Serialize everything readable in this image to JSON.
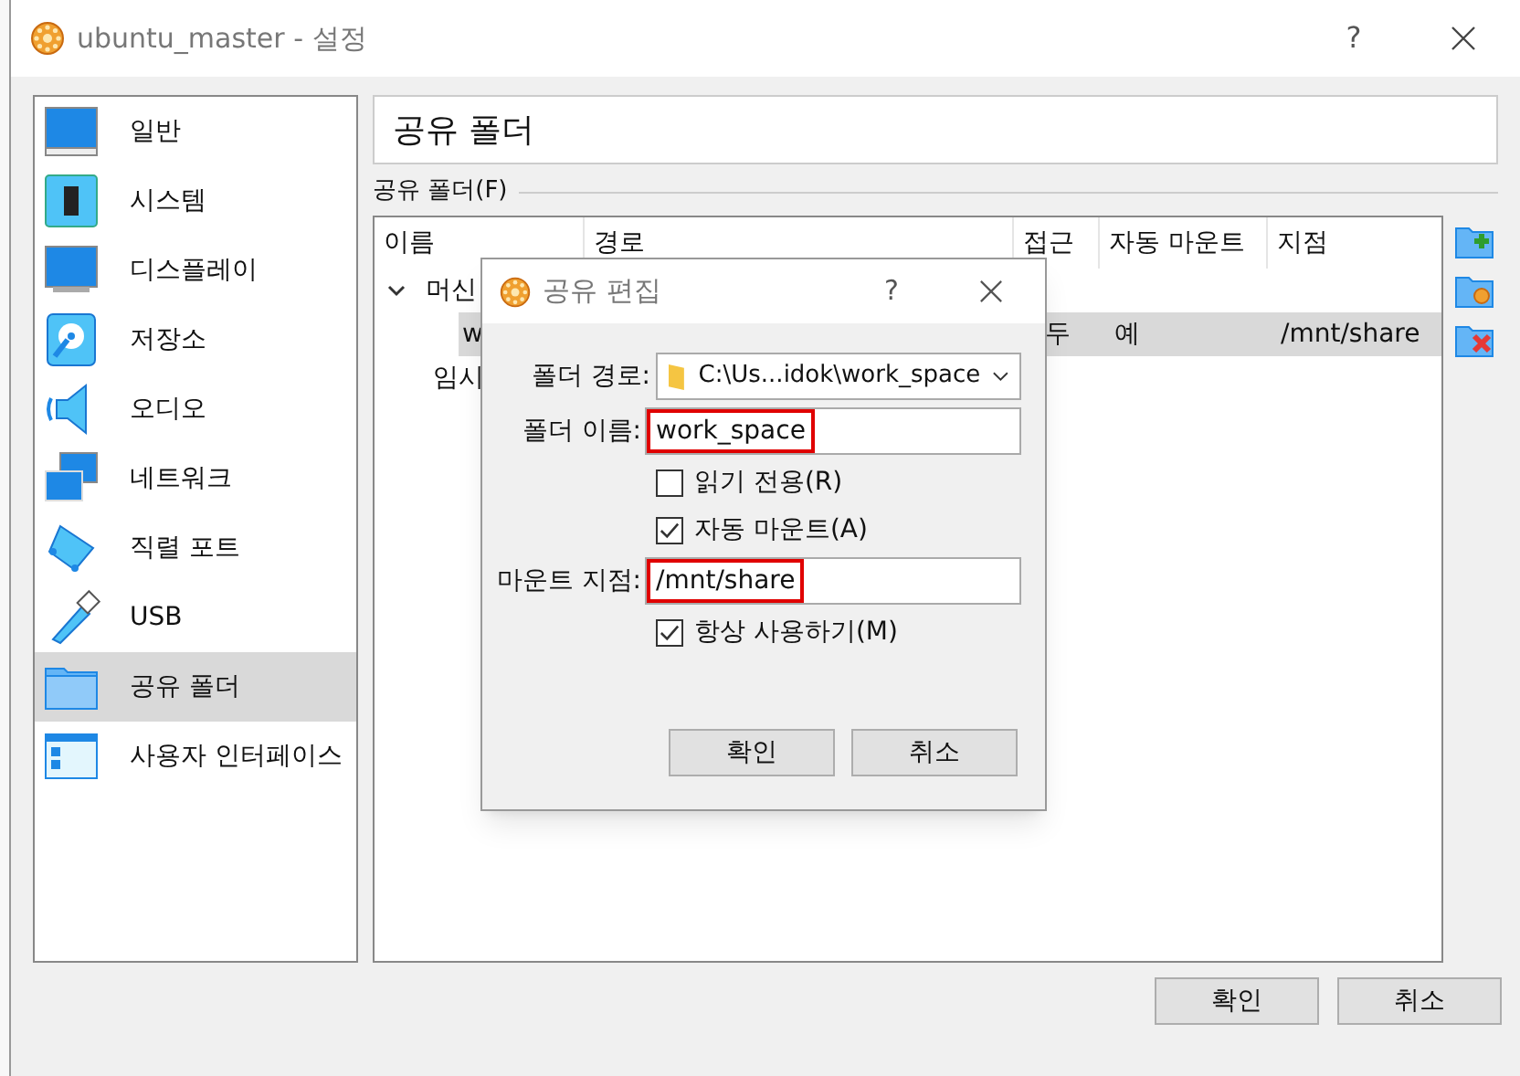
{
  "window": {
    "title": "ubuntu_master - 설정",
    "help": "?"
  },
  "sidebar": {
    "items": [
      {
        "label": "일반",
        "selected": false
      },
      {
        "label": "시스템",
        "selected": false
      },
      {
        "label": "디스플레이",
        "selected": false
      },
      {
        "label": "저장소",
        "selected": false
      },
      {
        "label": "오디오",
        "selected": false
      },
      {
        "label": "네트워크",
        "selected": false
      },
      {
        "label": "직렬 포트",
        "selected": false
      },
      {
        "label": "USB",
        "selected": false
      },
      {
        "label": "공유 폴더",
        "selected": true
      },
      {
        "label": "사용자 인터페이스",
        "selected": false
      }
    ]
  },
  "page_title": "공유 폴더",
  "group_label": "공유 폴더(F)",
  "table": {
    "columns": [
      "이름",
      "경로",
      "접근",
      "자동 마운트",
      "지점"
    ],
    "rows": [
      {
        "cells": [
          "머신"
        ],
        "expanded": true,
        "selected": false
      },
      {
        "cells": [
          "w",
          "",
          "두",
          "예",
          "/mnt/share"
        ],
        "selected": true
      },
      {
        "cells": [
          "임시"
        ],
        "selected": false
      }
    ]
  },
  "dialog": {
    "title": "공유 편집",
    "help": "?",
    "path": {
      "label": "폴더 경로:",
      "value": "C:\\Us...idok\\work_space"
    },
    "name": {
      "label": "폴더 이름:",
      "value": "work_space",
      "highlighted": true
    },
    "read_only": {
      "label": "읽기 전용(R)",
      "checked": false
    },
    "auto_mount": {
      "label": "자동 마운트(A)",
      "checked": true
    },
    "mount_point": {
      "label": "마운트 지점:",
      "value": "/mnt/share",
      "highlighted": true
    },
    "permanent": {
      "label": "항상 사용하기(M)",
      "checked": true
    },
    "buttons": [
      "확인",
      "취소"
    ]
  },
  "buttons": [
    "확인",
    "취소"
  ]
}
